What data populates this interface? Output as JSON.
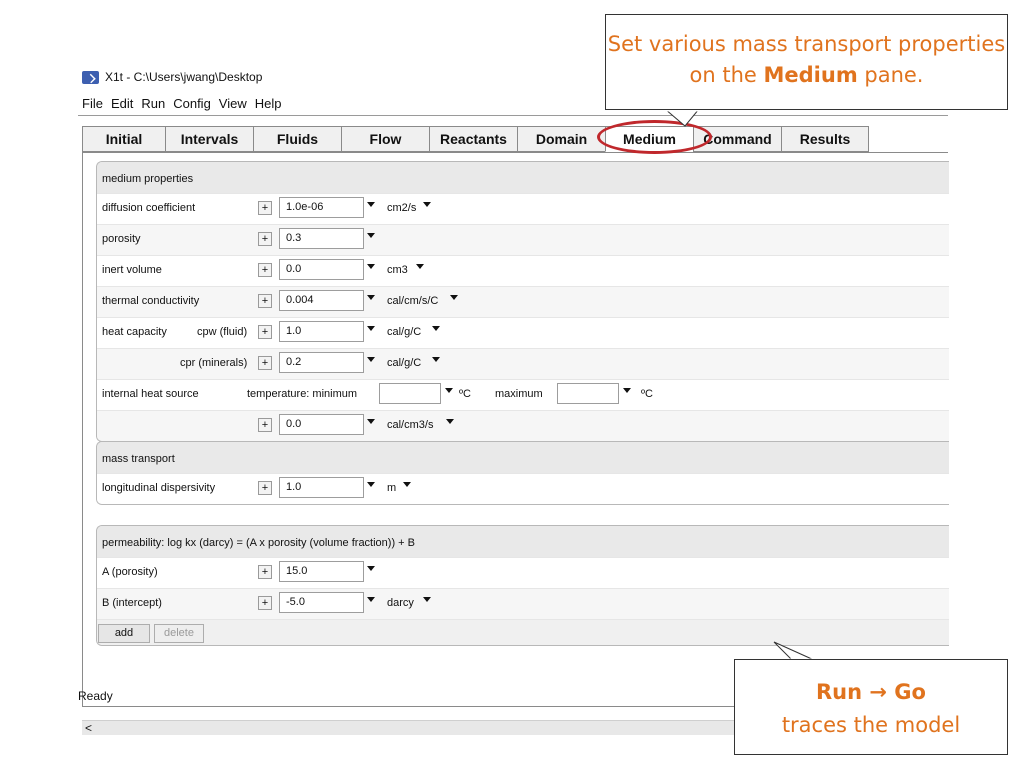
{
  "window": {
    "title": "X1t - C:\\Users\\jwang\\Desktop",
    "menus": [
      "File",
      "Edit",
      "Run",
      "Config",
      "View",
      "Help"
    ]
  },
  "tabs": [
    "Initial",
    "Intervals",
    "Fluids",
    "Flow",
    "Reactants",
    "Domain",
    "Medium",
    "Command",
    "Results"
  ],
  "active_tab": "Medium",
  "medium_properties": {
    "header": "medium properties",
    "diffusion": {
      "label": "diffusion coefficient",
      "value": "1.0e-06",
      "unit": "cm2/s"
    },
    "porosity": {
      "label": "porosity",
      "value": "0.3"
    },
    "inert_volume": {
      "label": "inert volume",
      "value": "0.0",
      "unit": "cm3"
    },
    "thermal_conductivity": {
      "label": "thermal conductivity",
      "value": "0.004",
      "unit": "cal/cm/s/C"
    },
    "heat_capacity": {
      "label": "heat capacity",
      "cpw_label": "cpw (fluid)",
      "cpw_value": "1.0",
      "cpw_unit": "cal/g/C",
      "cpr_label": "cpr (minerals)",
      "cpr_value": "0.2",
      "cpr_unit": "cal/g/C"
    },
    "heat_source": {
      "label": "internal heat source",
      "temp_label": "temperature:  minimum",
      "min_value": "",
      "min_unit": "ºC",
      "max_label": "maximum",
      "max_value": "",
      "max_unit": "ºC",
      "value": "0.0",
      "unit": "cal/cm3/s"
    }
  },
  "mass_transport": {
    "header": "mass transport",
    "dispersivity": {
      "label": "longitudinal dispersivity",
      "value": "1.0",
      "unit": "m"
    }
  },
  "permeability": {
    "header": "permeability: log kx (darcy) = (A x porosity (volume fraction)) + B",
    "a": {
      "label": "A (porosity)",
      "value": "15.0"
    },
    "b": {
      "label": "B (intercept)",
      "value": "-5.0",
      "unit": "darcy"
    },
    "add_label": "add",
    "delete_label": "delete"
  },
  "plus_symbol": "+",
  "scroll_arrow": "<",
  "status": "Ready",
  "callouts": {
    "top_pre": "Set various mass transport properties on the ",
    "top_bold": "Medium",
    "top_post": " pane.",
    "bottom_title": "Run → Go",
    "bottom_text": "traces the model"
  },
  "colors": {
    "callout_text": "#e0731e",
    "highlight": "#c0282c"
  }
}
